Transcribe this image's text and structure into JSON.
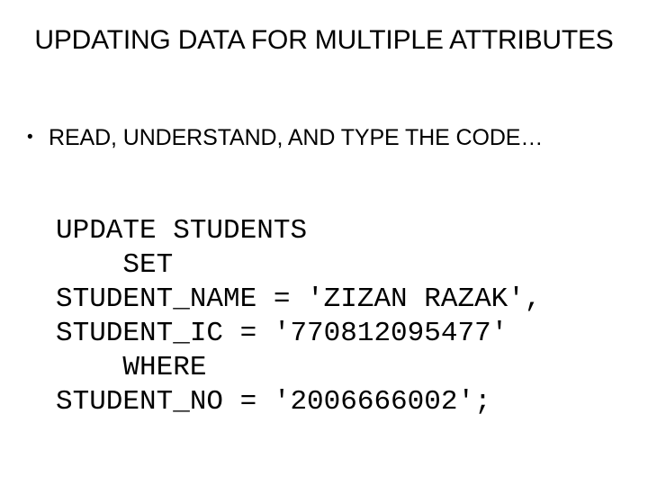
{
  "slide": {
    "background_color": "#ffffff",
    "text_color": "#000000",
    "title": "UPDATING DATA FOR MULTIPLE ATTRIBUTES",
    "bullets": [
      {
        "marker": "•",
        "text": "READ, UNDERSTAND, AND TYPE THE CODE…"
      }
    ],
    "code": {
      "language": "SQL",
      "lines": [
        "UPDATE STUDENTS",
        "    SET",
        "STUDENT_NAME = 'ZIZAN RAZAK',",
        "STUDENT_IC = '770812095477'",
        "    WHERE",
        "STUDENT_NO = '2006666002';"
      ]
    }
  }
}
